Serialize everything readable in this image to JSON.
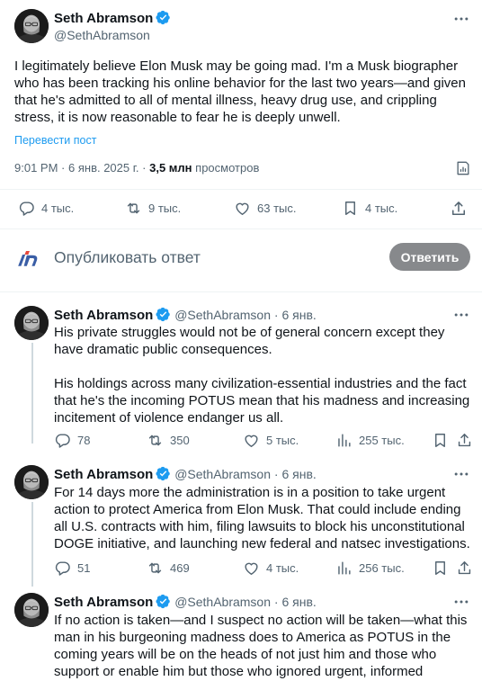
{
  "main_tweet": {
    "author_name": "Seth Abramson",
    "handle": "@SethAbramson",
    "text": "I legitimately believe Elon Musk may be going mad. I'm a Musk biographer who has been tracking his online behavior for the last two years—and given that he's admitted to all of mental illness, heavy drug use, and crippling stress, it is now reasonable to fear he is deeply unwell.",
    "translate_label": "Перевести пост",
    "time": "9:01 PM",
    "date": "6 янв. 2025 г.",
    "views_count": "3,5 млн",
    "views_label": "просмотров",
    "stats": {
      "replies": "4 тыс.",
      "reposts": "9 тыс.",
      "likes": "63 тыс.",
      "bookmarks": "4 тыс."
    }
  },
  "reply_composer": {
    "placeholder": "Опубликовать ответ",
    "button_label": "Ответить"
  },
  "replies": [
    {
      "author_name": "Seth Abramson",
      "handle": "@SethAbramson",
      "date": "6 янв.",
      "paragraphs": [
        "His private struggles would not be of general concern except they have dramatic public consequences.",
        "His holdings across many civilization-essential industries and the fact that he's the incoming POTUS mean that his madness and increasing incitement of violence endanger us all."
      ],
      "stats": {
        "replies": "78",
        "reposts": "350",
        "likes": "5 тыс.",
        "views": "255 тыс."
      }
    },
    {
      "author_name": "Seth Abramson",
      "handle": "@SethAbramson",
      "date": "6 янв.",
      "paragraphs": [
        "For 14 days more the administration is in a position to take urgent action to protect America from Elon Musk. That could include ending all U.S. contracts with him, filing lawsuits to block his unconstitutional DOGE initiative, and launching new federal and natsec investigations."
      ],
      "stats": {
        "replies": "51",
        "reposts": "469",
        "likes": "4 тыс.",
        "views": "256 тыс."
      }
    },
    {
      "author_name": "Seth Abramson",
      "handle": "@SethAbramson",
      "date": "6 янв.",
      "paragraphs": [
        "If no action is taken—and I suspect no action will be taken—what this man in his burgeoning madness does to America as POTUS in the coming years will be on the heads of not just him and those who support or enable him but those who ignored urgent, informed warnings like this one."
      ]
    }
  ],
  "colors": {
    "verified_blue": "#1d9bf0",
    "link_blue": "#1d9bf0",
    "grey_text": "#536471",
    "button_bg": "#87898c",
    "thread_line": "#cfd9de"
  }
}
